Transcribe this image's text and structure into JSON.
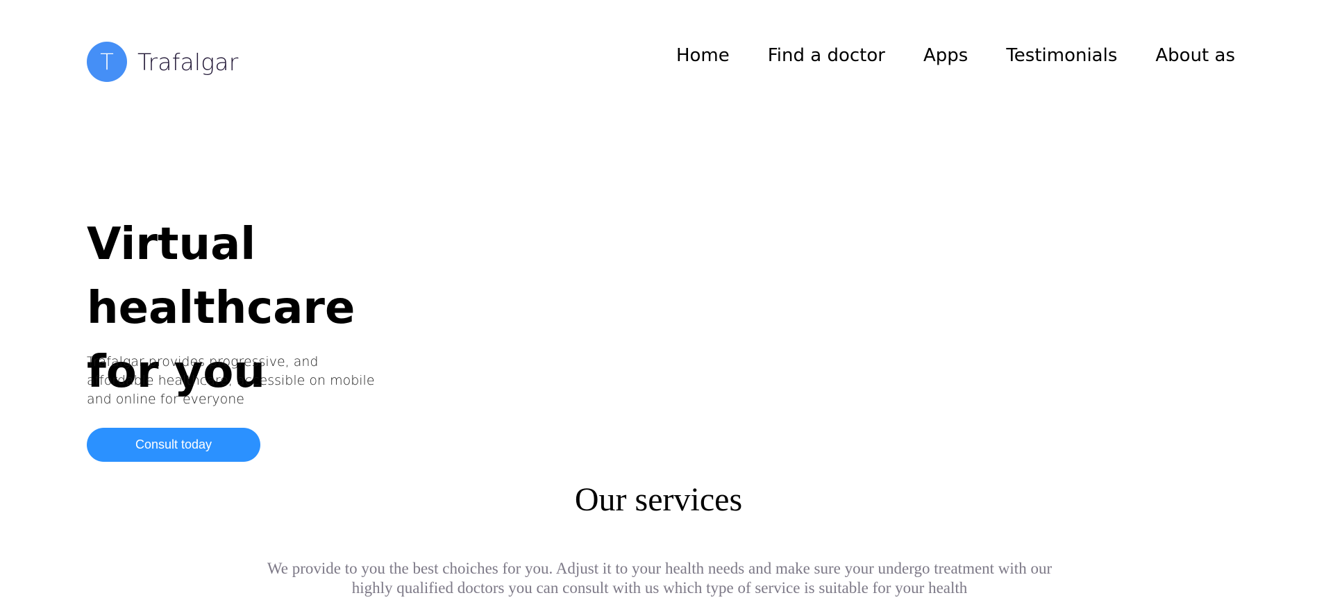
{
  "brand": {
    "initial": "T",
    "name": "Trafalgar",
    "color": "#458ff6"
  },
  "nav": {
    "items": [
      {
        "label": "Home"
      },
      {
        "label": "Find a doctor"
      },
      {
        "label": "Apps"
      },
      {
        "label": "Testimonials"
      },
      {
        "label": "About as"
      }
    ]
  },
  "hero": {
    "title_line1": "Virtual healthcare",
    "title_line2": "for you",
    "description": "Trafalgar provides progressive, and affordable healthcare, accessible on mobile and online for everyone",
    "cta_label": "Consult today",
    "cta_color": "#2b91ff"
  },
  "services": {
    "title": "Our services",
    "description": "We provide to you the best choiches for you. Adjust it to your health needs and make sure your undergo treatment with our highly qualified doctors you can consult with us which type of service is suitable for your health"
  }
}
